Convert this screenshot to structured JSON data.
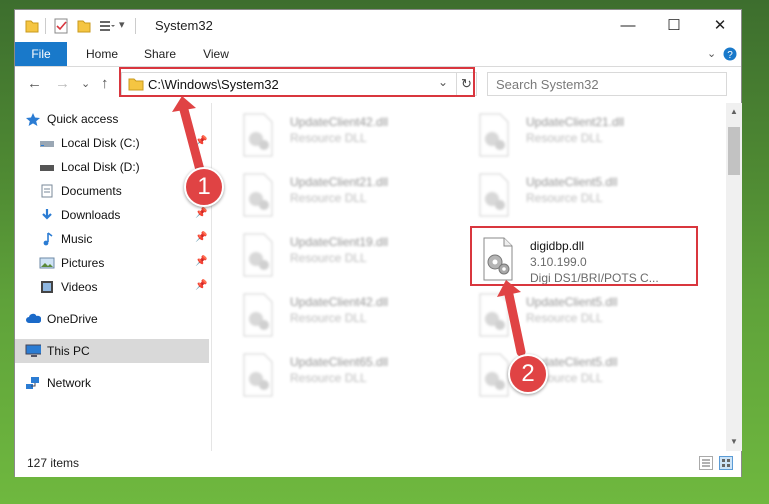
{
  "window": {
    "title": "System32",
    "controls": {
      "minimize": "—",
      "maximize": "☐",
      "close": "✕"
    }
  },
  "ribbon": {
    "tabs": [
      "File",
      "Home",
      "Share",
      "View"
    ],
    "expand_icon": "chevron-down-icon",
    "help_icon": "help-icon"
  },
  "nav": {
    "back": "←",
    "forward": "→",
    "recent": "⌄",
    "up": "↑",
    "address": "C:\\Windows\\System32",
    "address_dropdown": "⌄",
    "refresh": "↻",
    "search_placeholder": "Search System32"
  },
  "sidebar": {
    "items": [
      {
        "label": "Quick access",
        "icon": "star-icon",
        "pinned": false
      },
      {
        "label": "Local Disk (C:)",
        "icon": "drive-icon",
        "pinned": true
      },
      {
        "label": "Local Disk (D:)",
        "icon": "drive-icon",
        "pinned": false
      },
      {
        "label": "Documents",
        "icon": "documents-icon",
        "pinned": false
      },
      {
        "label": "Downloads",
        "icon": "download-icon",
        "pinned": true
      },
      {
        "label": "Music",
        "icon": "music-icon",
        "pinned": true
      },
      {
        "label": "Pictures",
        "icon": "pictures-icon",
        "pinned": true
      },
      {
        "label": "Videos",
        "icon": "video-icon",
        "pinned": true
      },
      {
        "label": "OneDrive",
        "icon": "cloud-icon",
        "pinned": false
      },
      {
        "label": "This PC",
        "icon": "computer-icon",
        "pinned": false,
        "selected": true
      },
      {
        "label": "Network",
        "icon": "network-icon",
        "pinned": false
      }
    ],
    "pin_glyph": "📌"
  },
  "files": {
    "left_column": [
      {
        "name": "UpdateClient42.dll",
        "desc": "Resource DLL"
      },
      {
        "name": "UpdateClient21.dll",
        "desc": "Resource DLL"
      },
      {
        "name": "UpdateClient19.dll",
        "desc": "Resource DLL"
      },
      {
        "name": "UpdateClient42.dll",
        "desc": "Resource DLL"
      },
      {
        "name": "UpdateClient65.dll",
        "desc": "Resource DLL"
      }
    ],
    "right_column": [
      {
        "name": "UpdateClient21.dll",
        "desc": "Resource DLL"
      },
      {
        "name": "UpdateClient5.dll",
        "desc": "Resource DLL"
      },
      {
        "name": "UpdateClient5.dll",
        "desc": "Resource DLL"
      },
      {
        "name": "UpdateClient5.dll",
        "desc": "Resource DLL"
      }
    ],
    "highlighted": {
      "name": "digidbp.dll",
      "version": "3.10.199.0",
      "desc": "Digi DS1/BRI/POTS C..."
    }
  },
  "status": {
    "item_count": "127 items"
  },
  "callouts": {
    "one": "1",
    "two": "2"
  },
  "colors": {
    "accent": "#1979ca",
    "callout": "#e04344",
    "highlight_box": "#d9363e"
  }
}
